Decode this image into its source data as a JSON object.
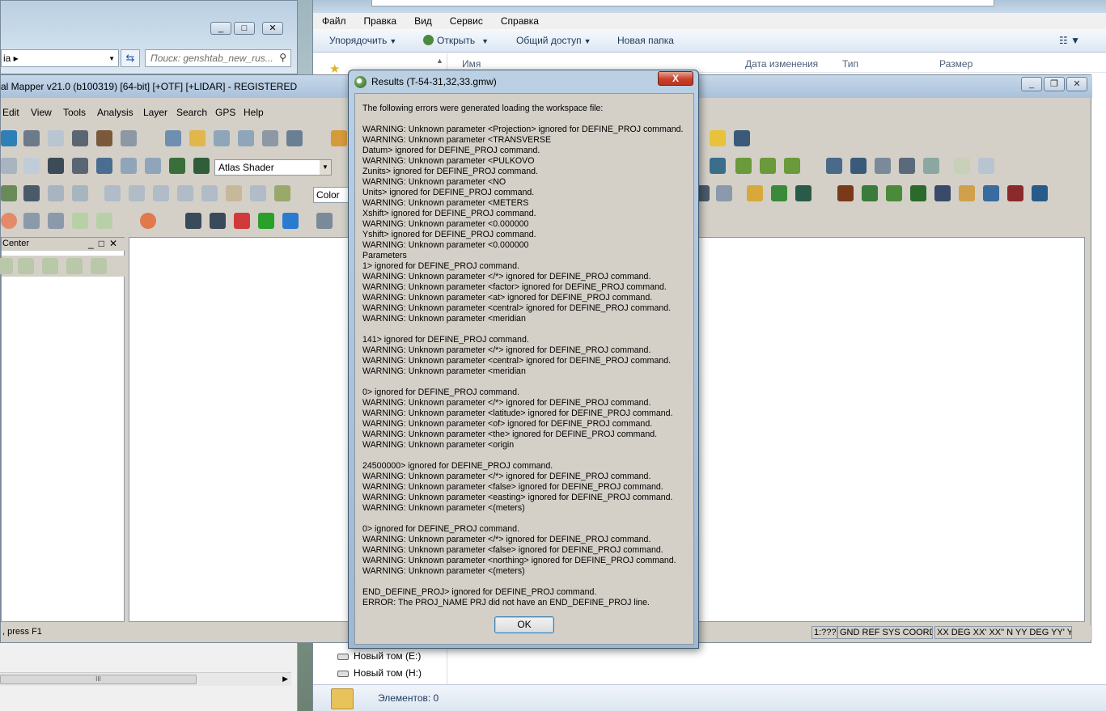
{
  "explorer": {
    "menu": [
      "Файл",
      "Правка",
      "Вид",
      "Сервис",
      "Справка"
    ],
    "commands": {
      "organize": "Упорядочить",
      "open": "Открыть",
      "share": "Общий доступ",
      "new_folder": "Новая папка"
    },
    "columns": {
      "name": "Имя",
      "date": "Дата изменения",
      "type": "Тип",
      "size": "Размер"
    },
    "drives": [
      "Новый том (E:)",
      "Новый том (H:)"
    ],
    "status_count": "Элементов: 0"
  },
  "left_window": {
    "address_text": "ia",
    "search_placeholder": "Поиск: genshtab_new_rus..."
  },
  "global_mapper": {
    "title": "al Mapper v21.0 (b100319) [64-bit] [+OTF] [+LIDAR] - REGISTERED",
    "menu": [
      "Edit",
      "View",
      "Tools",
      "Analysis",
      "Layer",
      "Search",
      "GPS",
      "Help"
    ],
    "shader_value": "Atlas Shader",
    "color_value": "Color Li",
    "control_center_title": "Center",
    "status_left": ", press F1",
    "status_cells": [
      "1:???",
      "GND REF SYS COORDS",
      "XX DEG XX' XX\" N YY DEG YY' YY\" S"
    ]
  },
  "dialog": {
    "title": "Results (T-54-31,32,33.gmw)",
    "close_label": "X",
    "lines": [
      "The following errors were generated loading the workspace file:",
      "",
      "WARNING: Unknown parameter <Projection> ignored for DEFINE_PROJ command.",
      "WARNING: Unknown parameter <TRANSVERSE",
      "Datum> ignored for DEFINE_PROJ command.",
      "WARNING: Unknown parameter <PULKOVO",
      "Zunits> ignored for DEFINE_PROJ command.",
      "WARNING: Unknown parameter <NO",
      "Units> ignored for DEFINE_PROJ command.",
      "WARNING: Unknown parameter <METERS",
      "Xshift> ignored for DEFINE_PROJ command.",
      "WARNING: Unknown parameter <0.000000",
      "Yshift> ignored for DEFINE_PROJ command.",
      "WARNING: Unknown parameter <0.000000",
      "Parameters",
      "1> ignored for DEFINE_PROJ command.",
      "WARNING: Unknown parameter </*> ignored for DEFINE_PROJ command.",
      "WARNING: Unknown parameter <factor> ignored for DEFINE_PROJ command.",
      "WARNING: Unknown parameter <at> ignored for DEFINE_PROJ command.",
      "WARNING: Unknown parameter <central> ignored for DEFINE_PROJ command.",
      "WARNING: Unknown parameter <meridian",
      "",
      "141> ignored for DEFINE_PROJ command.",
      "WARNING: Unknown parameter </*> ignored for DEFINE_PROJ command.",
      "WARNING: Unknown parameter <central> ignored for DEFINE_PROJ command.",
      "WARNING: Unknown parameter <meridian",
      "",
      "0> ignored for DEFINE_PROJ command.",
      "WARNING: Unknown parameter </*> ignored for DEFINE_PROJ command.",
      "WARNING: Unknown parameter <latitude> ignored for DEFINE_PROJ command.",
      "WARNING: Unknown parameter <of> ignored for DEFINE_PROJ command.",
      "WARNING: Unknown parameter <the> ignored for DEFINE_PROJ command.",
      "WARNING: Unknown parameter <origin",
      "",
      "24500000> ignored for DEFINE_PROJ command.",
      "WARNING: Unknown parameter </*> ignored for DEFINE_PROJ command.",
      "WARNING: Unknown parameter <false> ignored for DEFINE_PROJ command.",
      "WARNING: Unknown parameter <easting> ignored for DEFINE_PROJ command.",
      "WARNING: Unknown parameter <(meters)",
      "",
      "0> ignored for DEFINE_PROJ command.",
      "WARNING: Unknown parameter </*> ignored for DEFINE_PROJ command.",
      "WARNING: Unknown parameter <false> ignored for DEFINE_PROJ command.",
      "WARNING: Unknown parameter <northing> ignored for DEFINE_PROJ command.",
      "WARNING: Unknown parameter <(meters)",
      "",
      "END_DEFINE_PROJ> ignored for DEFINE_PROJ command.",
      "ERROR: The PROJ_NAME PRJ did not have an END_DEFINE_PROJ line."
    ],
    "ok_label": "OK"
  }
}
